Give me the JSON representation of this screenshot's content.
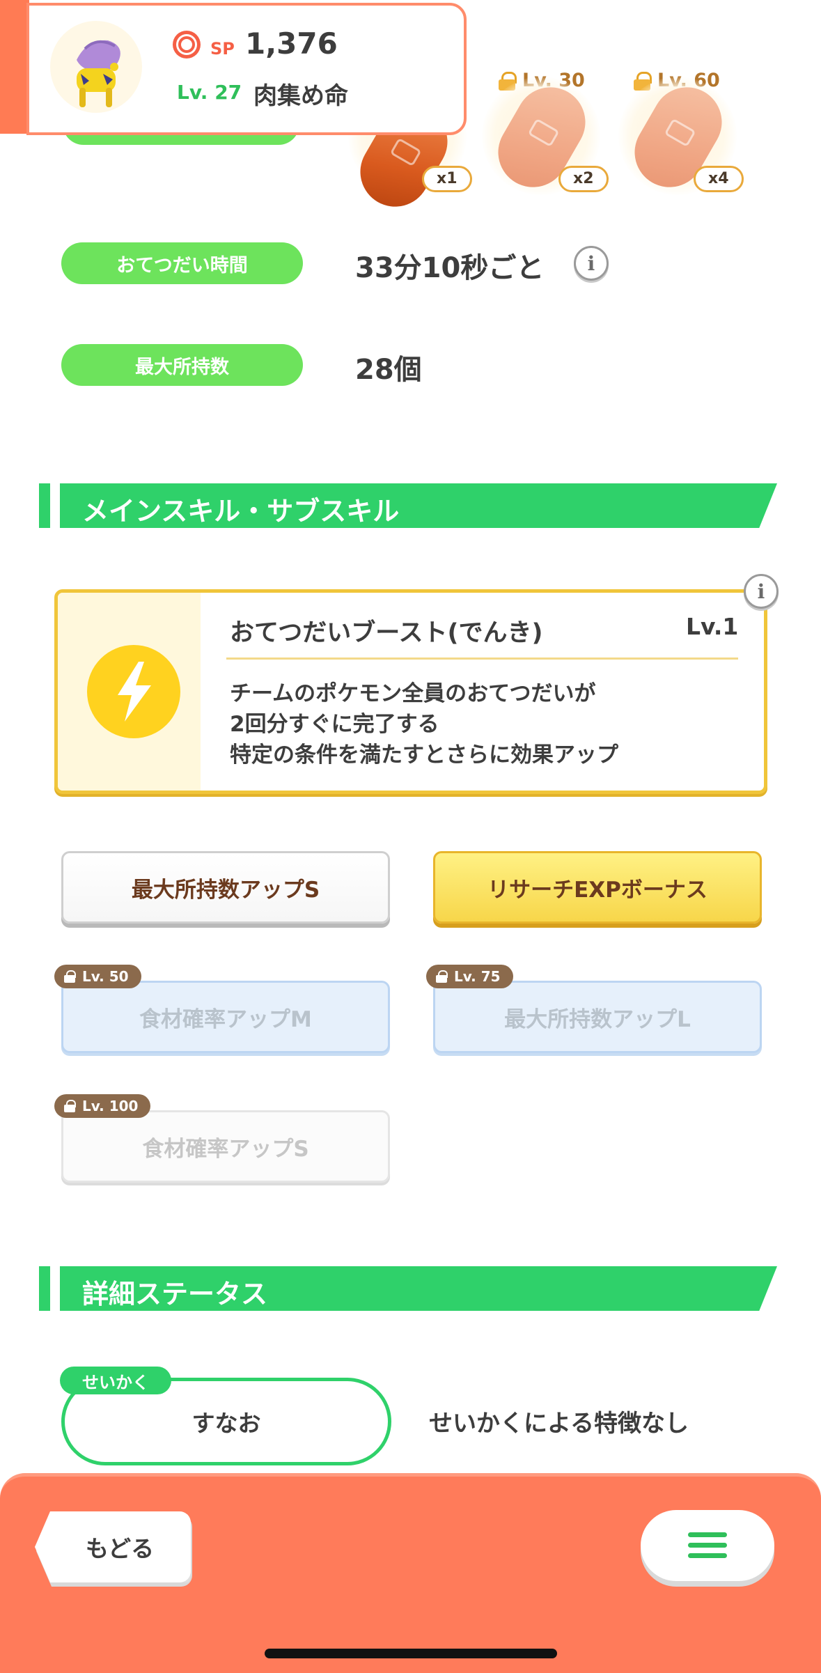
{
  "header": {
    "sp_label": "SP",
    "sp_value": "1,376",
    "level": "Lv. 27",
    "pokemon_name": "肉集め命"
  },
  "ingredients": [
    {
      "qty": "x1",
      "locked": false
    },
    {
      "lock_level": "Lv. 30",
      "qty": "x2",
      "locked": true
    },
    {
      "lock_level": "Lv. 60",
      "qty": "x4",
      "locked": true
    }
  ],
  "info_rows": {
    "help_time_label": "おてつだい時間",
    "help_time_value": "33分10秒ごと",
    "max_carry_label": "最大所持数",
    "max_carry_value": "28個"
  },
  "skills_section": {
    "title": "メインスキル・サブスキル",
    "main_skill": {
      "name": "おてつだいブースト(でんき)",
      "level": "Lv.1",
      "desc_line1": "チームのポケモン全員のおてつだいが",
      "desc_line2": "2回分すぐに完了する",
      "desc_line3": "特定の条件を満たすとさらに効果アップ"
    },
    "sub_skills": [
      {
        "label": "最大所持数アップS"
      },
      {
        "label": "リサーチEXPボーナス"
      },
      {
        "label": "食材確率アップM",
        "lock_level": "Lv. 50"
      },
      {
        "label": "最大所持数アップL",
        "lock_level": "Lv. 75"
      },
      {
        "label": "食材確率アップS",
        "lock_level": "Lv. 100"
      }
    ]
  },
  "status_section": {
    "title": "詳細ステータス",
    "nature_tag": "せいかく",
    "nature_value": "すなお",
    "nature_desc": "せいかくによる特徴なし"
  },
  "bottom": {
    "back_label": "もどる"
  }
}
